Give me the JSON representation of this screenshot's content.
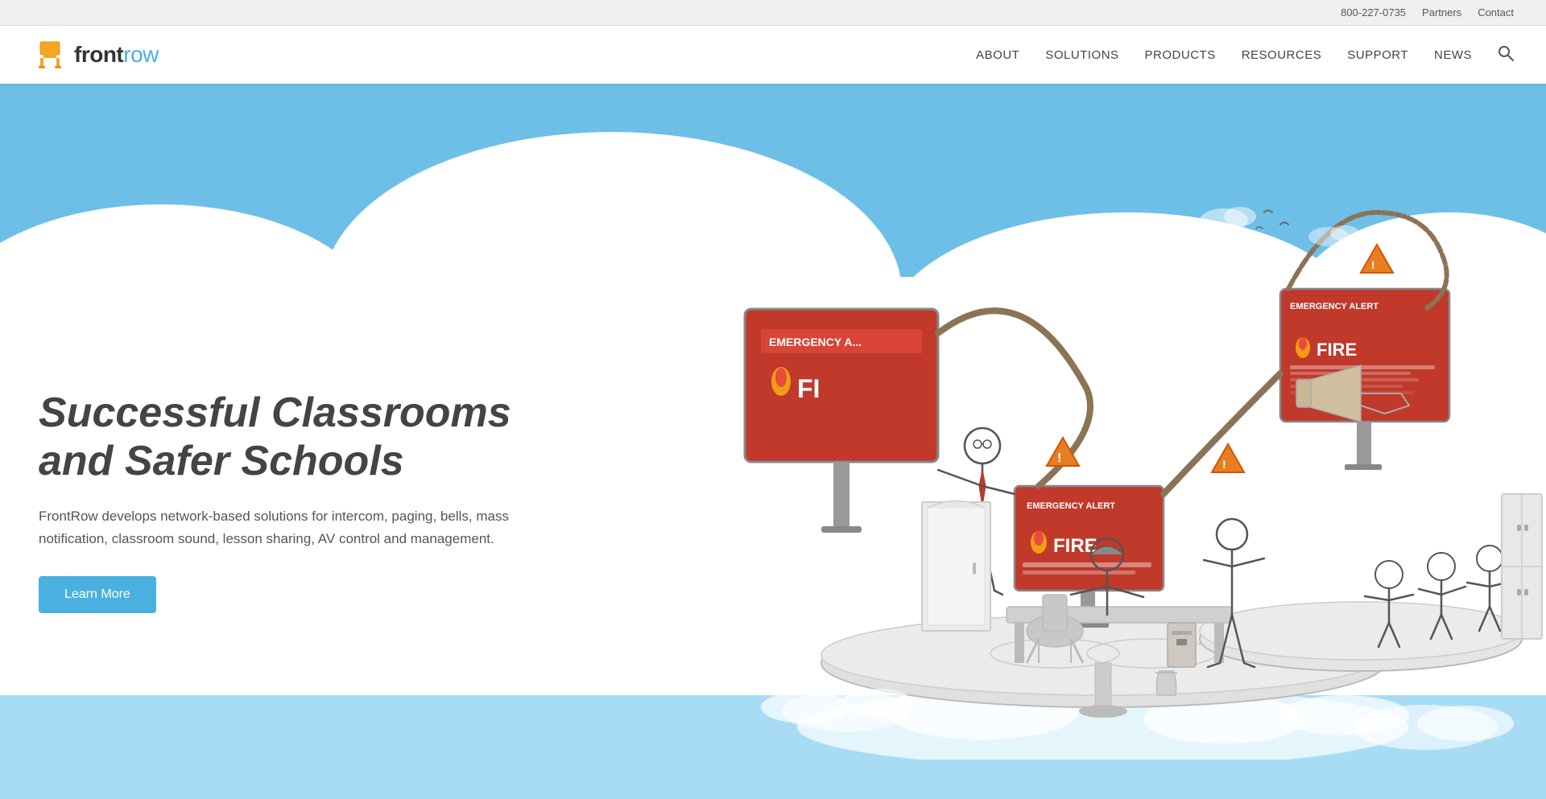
{
  "utility_bar": {
    "phone": "800-227-0735",
    "partners_label": "Partners",
    "contact_label": "Contact"
  },
  "nav": {
    "logo_front": "front",
    "logo_row": "row",
    "links": [
      {
        "label": "ABOUT",
        "id": "about"
      },
      {
        "label": "SOLUTIONS",
        "id": "solutions"
      },
      {
        "label": "PRODUCTS",
        "id": "products"
      },
      {
        "label": "RESOURCES",
        "id": "resources"
      },
      {
        "label": "SUPPORT",
        "id": "support"
      },
      {
        "label": "NEWS",
        "id": "news"
      }
    ]
  },
  "hero": {
    "title": "Successful Classrooms and Safer Schools",
    "description": "FrontRow develops network-based solutions for intercom, paging, bells, mass notification, classroom sound, lesson sharing, AV control and management.",
    "cta_label": "Learn More",
    "emergency_text_1": "EMERGENCY A...",
    "emergency_text_2": "FIRE",
    "emergency_alert_label": "EMERGENCY ALERT",
    "fire_label": "FIRE"
  },
  "colors": {
    "sky_blue": "#5cb8e8",
    "button_blue": "#4ab0e0",
    "emergency_red": "#c0392b",
    "logo_blue": "#4ab0e0",
    "nav_text": "#444444",
    "hero_title": "#444444",
    "hero_desc": "#555555"
  }
}
